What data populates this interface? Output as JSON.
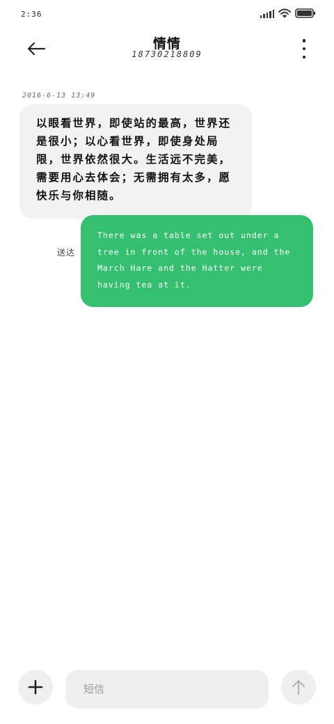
{
  "status_bar": {
    "time": "2:36",
    "icons": [
      "signal-icon",
      "wifi-icon",
      "battery-icon"
    ]
  },
  "header": {
    "contact_name": "情情",
    "contact_number": "18730218809"
  },
  "conversation": {
    "timestamp": "2016-6-13 13:49",
    "incoming_message": "以眼看世界，即使站的最高，世界还是很小；以心看世界，即使身处局限，世界依然很大。生活远不完美，需要用心去体会；无需拥有太多，愿快乐与你相随。",
    "outgoing_message": "There was a table set out under a tree in front of the house, and the March Hare and the Hatter were having tea at it.",
    "outgoing_status": "送达"
  },
  "composer": {
    "placeholder": "短信",
    "add_icon": "plus-icon",
    "send_icon": "arrow-up-icon"
  },
  "colors": {
    "outgoing_bubble": "#35c070",
    "incoming_bubble": "#f2f2f2",
    "button_bg": "#efefef"
  }
}
